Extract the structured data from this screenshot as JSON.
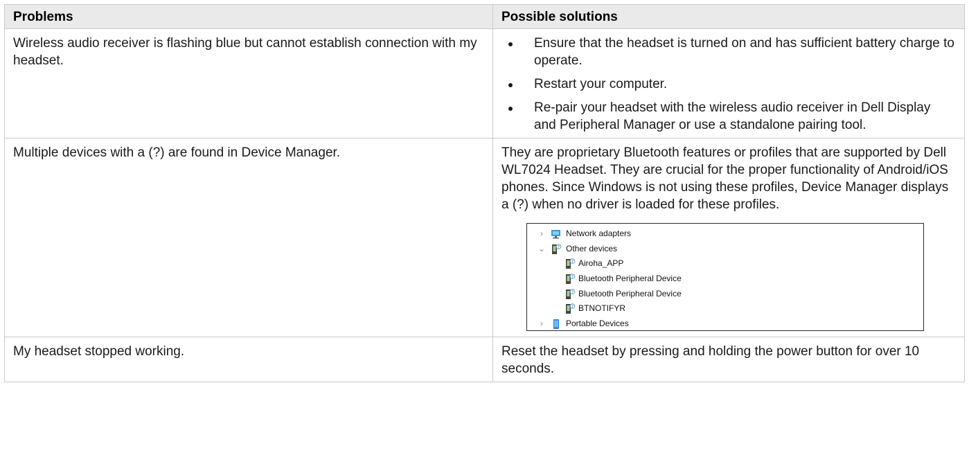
{
  "headers": {
    "problems": "Problems",
    "solutions": "Possible solutions"
  },
  "rows": [
    {
      "problem": "Wireless audio receiver is flashing blue but cannot establish connection with my headset.",
      "solutions": [
        "Ensure that the headset is turned on and has sufficient battery charge to operate.",
        "Restart your computer.",
        "Re-pair your headset with the wireless audio receiver in Dell Display and Peripheral Manager or use a standalone pairing tool."
      ]
    },
    {
      "problem": "Multiple devices with a (?) are found in Device Manager.",
      "solution_text": "They are proprietary Bluetooth features or profiles that are supported by Dell WL7024 Headset. They are crucial for the proper functionality of Android/iOS phones. Since Windows is not using these profiles, Device Manager displays a (?) when no driver is loaded for these profiles.",
      "device_manager": [
        {
          "label": "Network adapters",
          "icon": "network-adapter-icon",
          "expander": "›"
        },
        {
          "label": "Other devices",
          "icon": "unknown-device-icon",
          "expander": "⌄"
        },
        {
          "label": "Airoha_APP",
          "icon": "unknown-device-icon"
        },
        {
          "label": "Bluetooth Peripheral Device",
          "icon": "unknown-device-icon"
        },
        {
          "label": "Bluetooth Peripheral Device",
          "icon": "unknown-device-icon"
        },
        {
          "label": "BTNOTIFYR",
          "icon": "unknown-device-icon"
        },
        {
          "label": "Portable Devices",
          "icon": "portable-device-icon",
          "expander": "›"
        }
      ]
    },
    {
      "problem": "My headset stopped working.",
      "solution_text": "Reset the headset by pressing and holding the power button for over 10 seconds."
    }
  ],
  "colors": {
    "header_bg": "#eaeaea",
    "border": "#c9c9c9",
    "text": "#1a1a1a"
  }
}
